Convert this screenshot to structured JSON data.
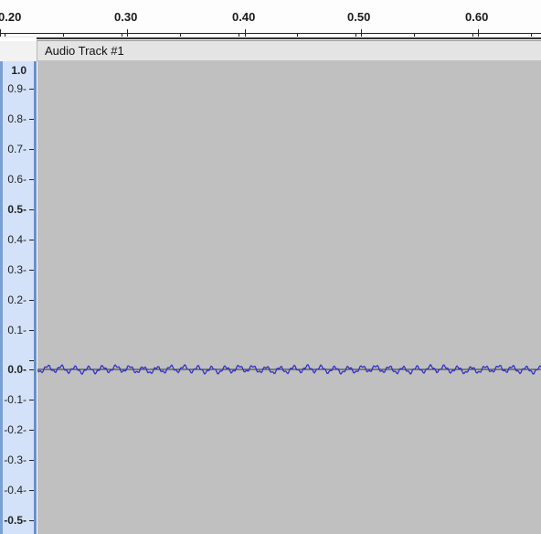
{
  "ruler": {
    "labels": [
      "0.20",
      "0.30",
      "0.40",
      "0.50",
      "0.60"
    ]
  },
  "track": {
    "name": "Audio Track #1",
    "background_color": "#c0c0c0",
    "waveform_color": "#3232c8"
  },
  "amplitude_ruler": {
    "labels": [
      "1.0",
      "0.9-",
      "0.8-",
      "0.7-",
      "0.6-",
      "0.5-",
      "0.4-",
      "0.3-",
      "0.2-",
      "0.1-",
      "0.0-",
      "-0.1-",
      "-0.2-",
      "-0.3-",
      "-0.4-",
      "-0.5-"
    ]
  }
}
